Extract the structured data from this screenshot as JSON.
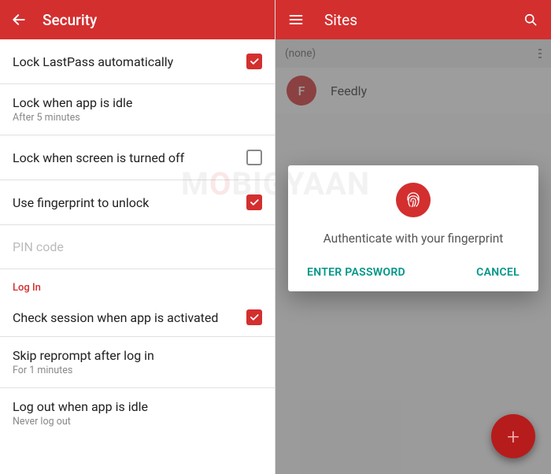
{
  "left": {
    "header_title": "Security",
    "rows": [
      {
        "label": "Lock LastPass automatically",
        "sub": "",
        "checked": true
      },
      {
        "label": "Lock when app is idle",
        "sub": "After 5 minutes",
        "checked": null
      },
      {
        "label": "Lock when screen is turned off",
        "sub": "",
        "checked": false
      },
      {
        "label": "Use fingerprint to unlock",
        "sub": "",
        "checked": true
      },
      {
        "label": "PIN code",
        "sub": "",
        "checked": null,
        "disabled": true
      }
    ],
    "section_login": "Log In",
    "rows2": [
      {
        "label": "Check session when app is activated",
        "sub": "",
        "checked": true
      },
      {
        "label": "Skip reprompt after log in",
        "sub": "For 1 minutes",
        "checked": null
      },
      {
        "label": "Log out when app is idle",
        "sub": "Never log out",
        "checked": null
      }
    ]
  },
  "right": {
    "header_title": "Sites",
    "group": "(none)",
    "site_initial": "F",
    "site_name": "Feedly",
    "dialog": {
      "text": "Authenticate with your fingerprint",
      "enter": "ENTER PASSWORD",
      "cancel": "CANCEL"
    }
  },
  "watermark_a": "M",
  "watermark_b": "O",
  "watermark_c": "BIGYAAN"
}
